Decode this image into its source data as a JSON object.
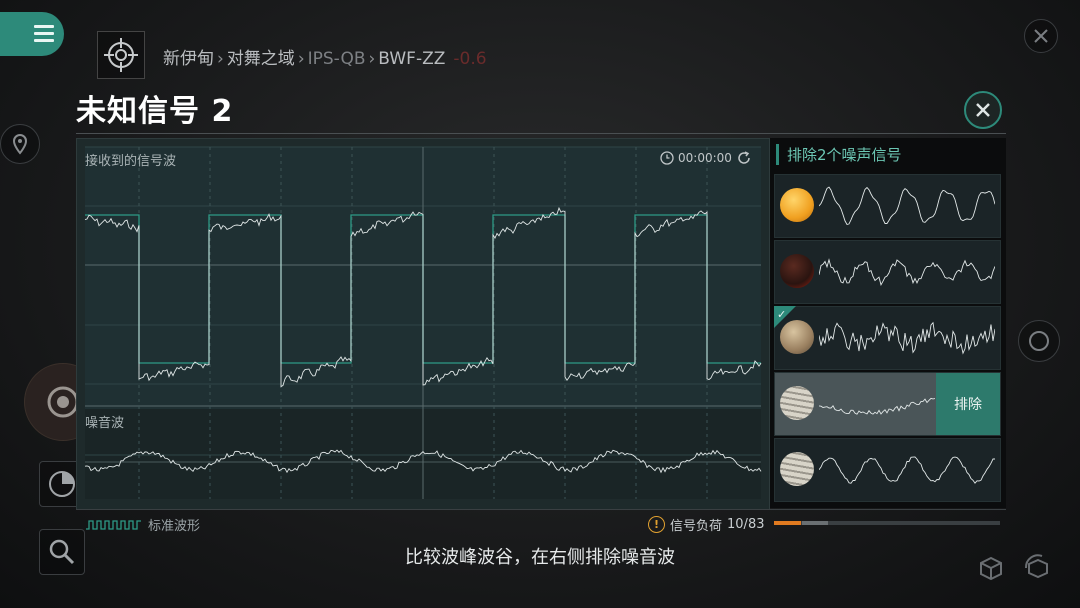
{
  "breadcrumb": {
    "items": [
      "新伊甸",
      "对舞之域",
      "IPS-QB",
      "BWF-ZZ"
    ],
    "security": "-0.6"
  },
  "title": "未知信号 2",
  "chart": {
    "received_label": "接收到的信号波",
    "noise_label": "噪音波",
    "timer": "00:00:00"
  },
  "right_panel": {
    "title": "排除2个噪声信号",
    "exclude_label": "排除",
    "cards": [
      {
        "planet": "sun",
        "color": "#f2b23a",
        "checked": false,
        "selected": false
      },
      {
        "planet": "lava",
        "color": "#7a2a1a",
        "checked": false,
        "selected": false
      },
      {
        "planet": "rock",
        "color": "#a89070",
        "checked": true,
        "selected": false
      },
      {
        "planet": "gas",
        "color": "#b8b4aa",
        "checked": false,
        "selected": true
      },
      {
        "planet": "gas",
        "color": "#c0bbb0",
        "checked": false,
        "selected": false
      }
    ]
  },
  "footer": {
    "standard_wave": "标准波形",
    "load_label": "信号负荷",
    "load_value": "10/83",
    "load_fraction": 0.12,
    "hint": "比较波峰波谷，在右侧排除噪音波"
  }
}
